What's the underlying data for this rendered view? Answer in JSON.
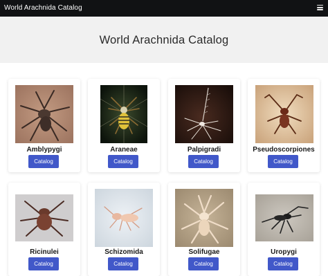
{
  "app": {
    "brand": "World Arachnida Catalog",
    "menu_icon": "hamburger-menu-icon"
  },
  "hero": {
    "title": "World Arachnida Catalog"
  },
  "cards": [
    {
      "name": "Amblypygi",
      "button": "Catalog",
      "image": "amblypygi-photo"
    },
    {
      "name": "Araneae",
      "button": "Catalog",
      "image": "araneae-photo"
    },
    {
      "name": "Palpigradi",
      "button": "Catalog",
      "image": "palpigradi-photo"
    },
    {
      "name": "Pseudoscorpiones",
      "button": "Catalog",
      "image": "pseudoscorpiones-photo"
    },
    {
      "name": "Ricinulei",
      "button": "Catalog",
      "image": "ricinulei-photo"
    },
    {
      "name": "Schizomida",
      "button": "Catalog",
      "image": "schizomida-photo"
    },
    {
      "name": "Solifugae",
      "button": "Catalog",
      "image": "solifugae-photo"
    },
    {
      "name": "Uropygi",
      "button": "Catalog",
      "image": "uropygi-photo"
    }
  ],
  "colors": {
    "navbar": "#111214",
    "hero_bg": "#f1f1f1",
    "button": "#4158c9"
  }
}
